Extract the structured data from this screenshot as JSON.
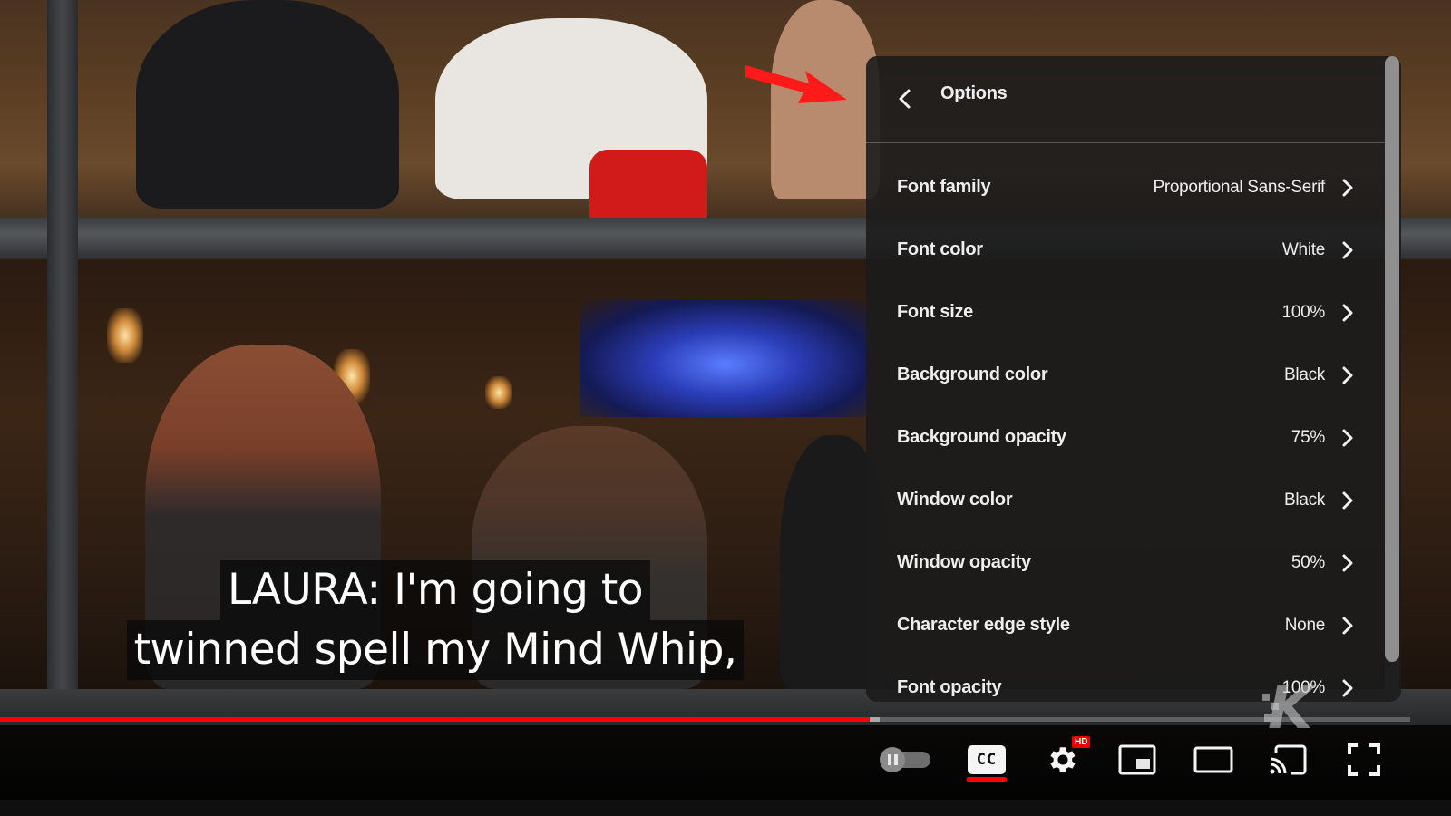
{
  "captions": {
    "lines": [
      "LAURA: I'm going to",
      "twinned spell my Mind Whip,"
    ]
  },
  "options_panel": {
    "title": "Options",
    "back_icon": "chevron-left-icon",
    "items": [
      {
        "label": "Font family",
        "value": "Proportional Sans-Serif"
      },
      {
        "label": "Font color",
        "value": "White"
      },
      {
        "label": "Font size",
        "value": "100%"
      },
      {
        "label": "Background color",
        "value": "Black"
      },
      {
        "label": "Background opacity",
        "value": "75%"
      },
      {
        "label": "Window color",
        "value": "Black"
      },
      {
        "label": "Window opacity",
        "value": "50%"
      },
      {
        "label": "Character edge style",
        "value": "None"
      },
      {
        "label": "Font opacity",
        "value": "100%"
      }
    ]
  },
  "progress": {
    "played_fraction": 0.617,
    "loaded_fraction": 0.624,
    "played_color": "#ff0000"
  },
  "controls": {
    "autoplay_toggle": {
      "icon": "pause-icon",
      "state": "on"
    },
    "subtitles": {
      "label": "CC",
      "active": true
    },
    "settings": {
      "icon": "gear-icon",
      "badge": "HD"
    },
    "miniplayer": {
      "icon": "miniplayer-icon"
    },
    "theater": {
      "icon": "theater-mode-icon"
    },
    "cast": {
      "icon": "cast-icon"
    },
    "fullscreen": {
      "icon": "fullscreen-icon"
    }
  },
  "watermark": {
    "text": "K"
  },
  "colors": {
    "accent_red": "#ff0000",
    "panel_bg": "#1c1c1c",
    "annotation_arrow": "#ff1a1a"
  }
}
